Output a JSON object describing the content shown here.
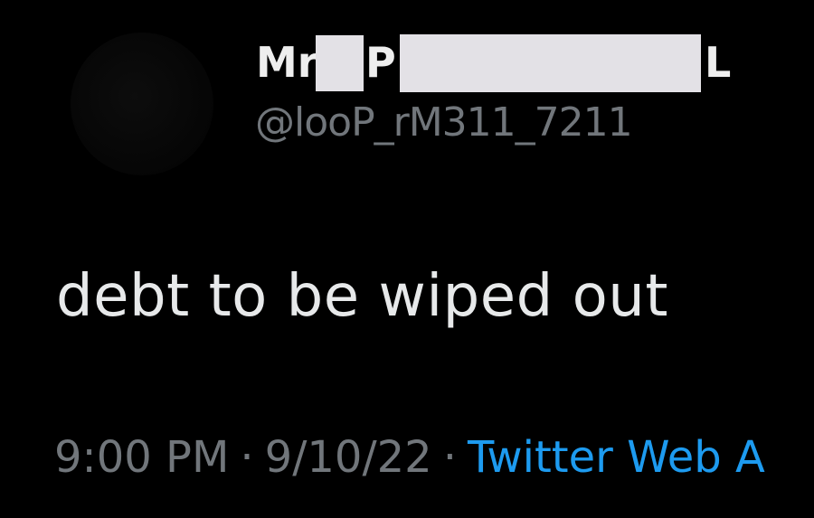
{
  "tweet": {
    "display_name_start": "Mr",
    "display_name_mid": "P",
    "display_name_end": "L",
    "handle": "@looP_rM311_7211",
    "text": "debt to be wiped out",
    "time": "9:00 PM",
    "separator": "·",
    "date": "9/10/22",
    "source": "Twitter Web A"
  },
  "colors": {
    "background": "#000000",
    "text": "#e7e9ea",
    "muted": "#71767b",
    "link": "#1d9bf0",
    "redaction": "#e3e1e6"
  }
}
